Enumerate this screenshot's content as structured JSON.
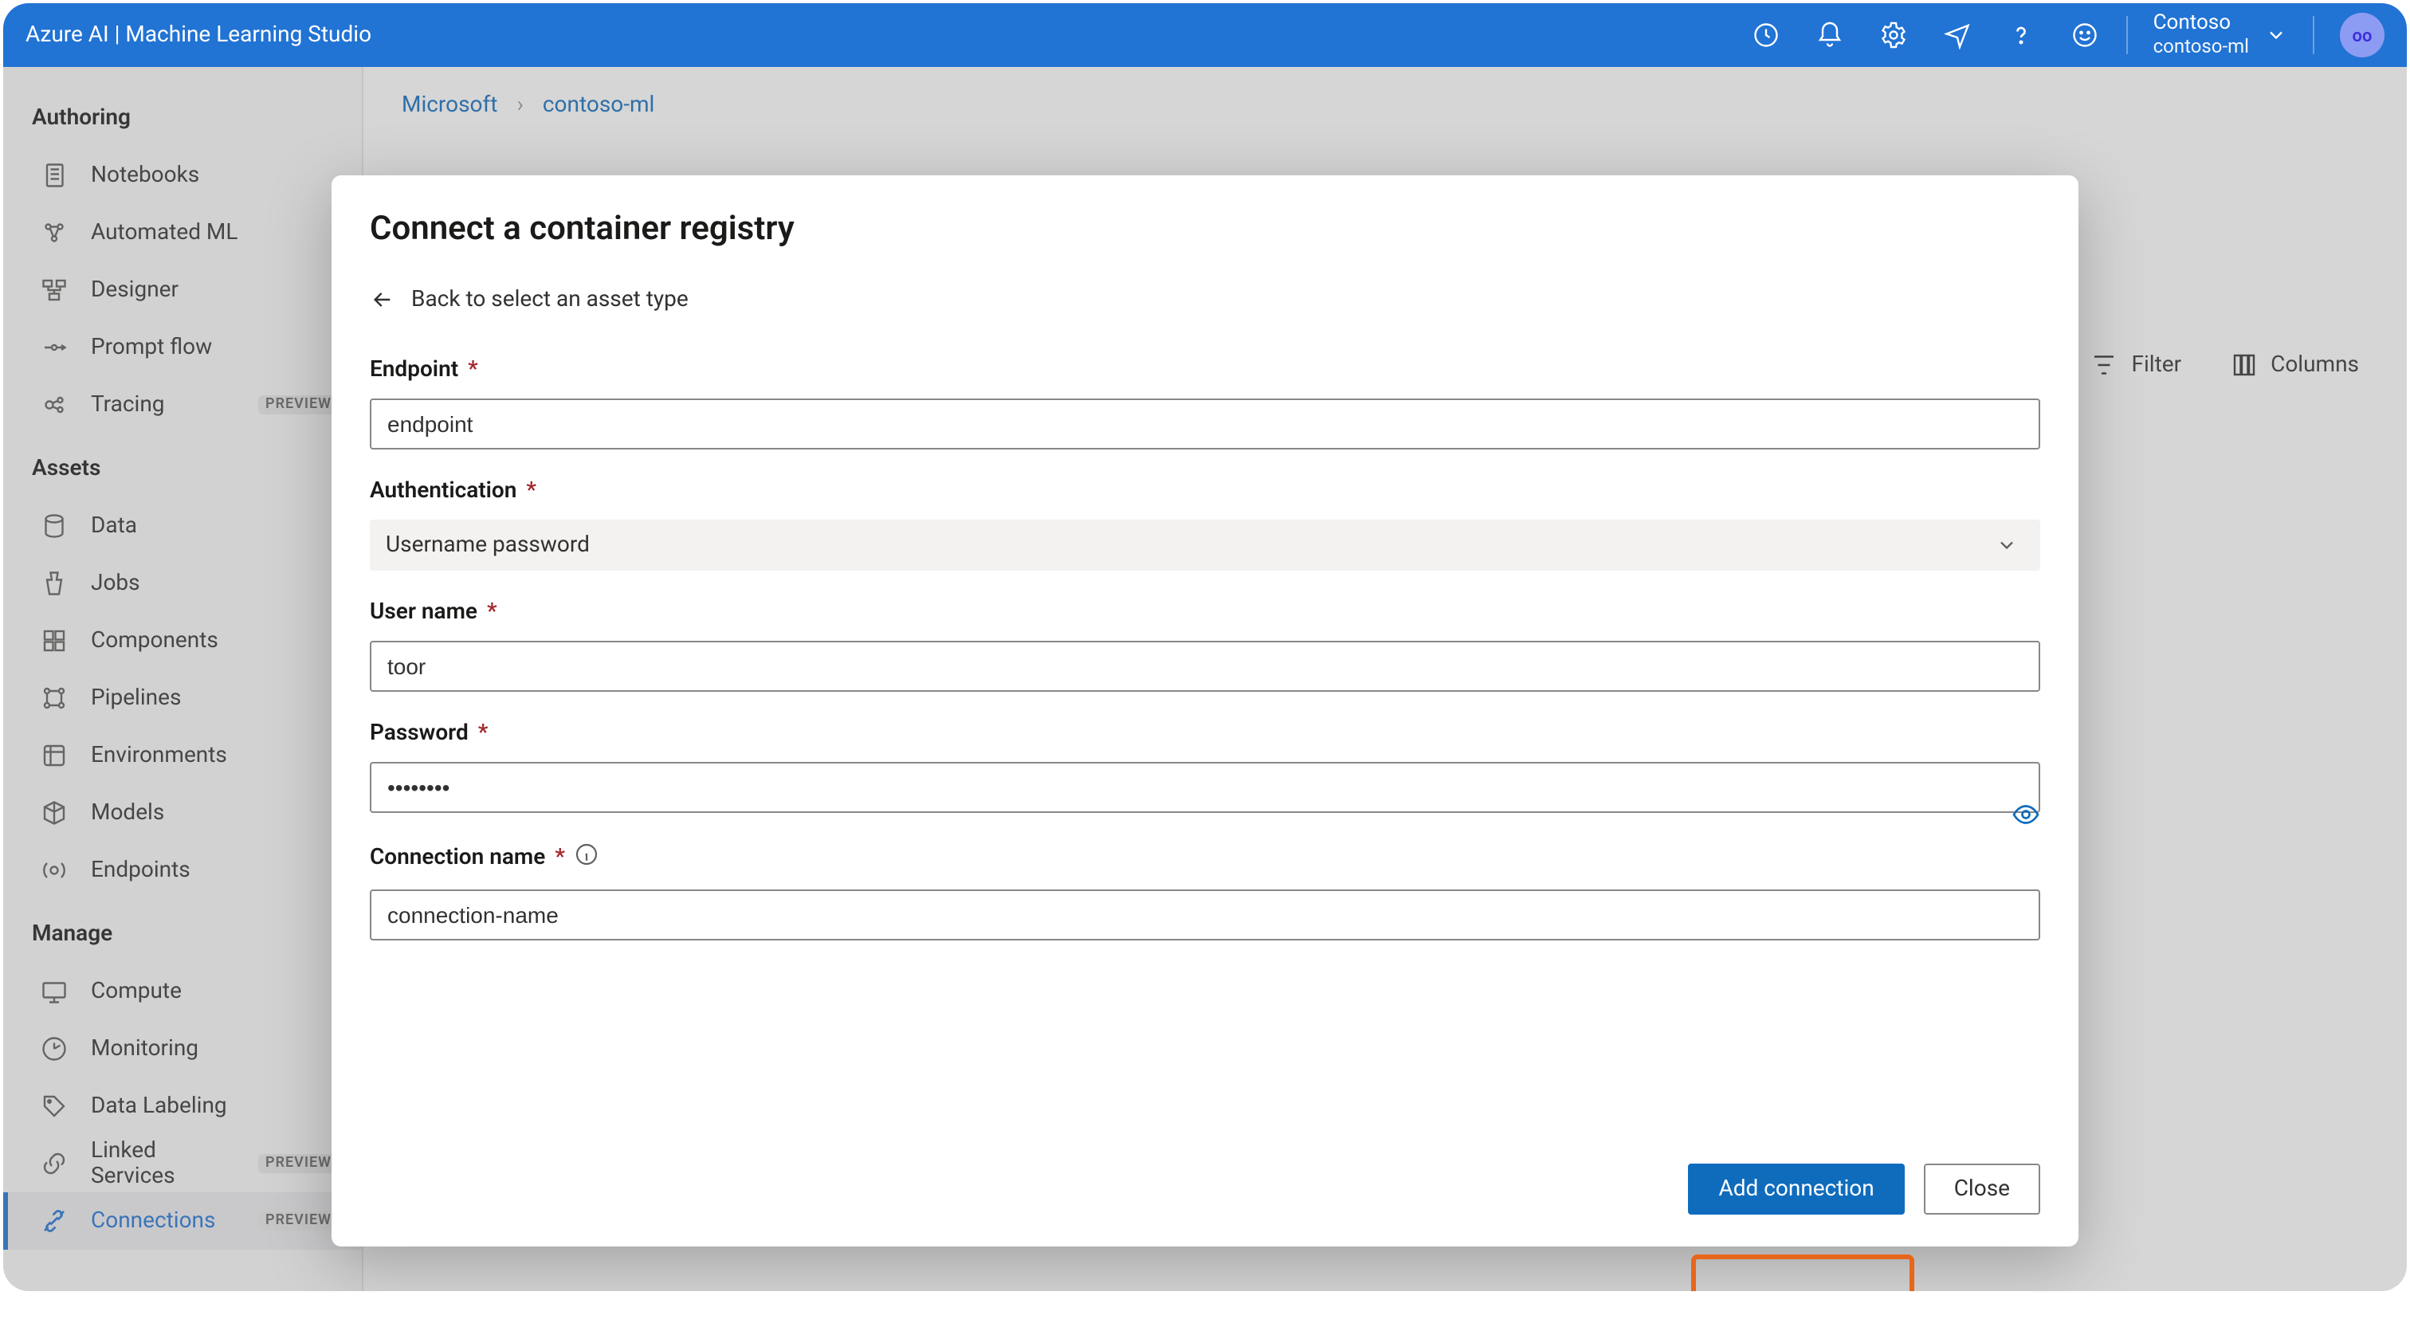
{
  "header": {
    "brand": "Azure AI | Machine Learning Studio",
    "workspace_directory": "Contoso",
    "workspace_name": "contoso-ml",
    "avatar_initials": "oo"
  },
  "sidebar": {
    "sections": [
      {
        "title": "Authoring",
        "items": [
          {
            "label": "Notebooks",
            "icon": "notebook"
          },
          {
            "label": "Automated ML",
            "icon": "automl"
          },
          {
            "label": "Designer",
            "icon": "designer"
          },
          {
            "label": "Prompt flow",
            "icon": "promptflow"
          },
          {
            "label": "Tracing",
            "icon": "tracing",
            "preview": true
          }
        ]
      },
      {
        "title": "Assets",
        "items": [
          {
            "label": "Data",
            "icon": "data"
          },
          {
            "label": "Jobs",
            "icon": "jobs"
          },
          {
            "label": "Components",
            "icon": "components"
          },
          {
            "label": "Pipelines",
            "icon": "pipelines"
          },
          {
            "label": "Environments",
            "icon": "environments"
          },
          {
            "label": "Models",
            "icon": "models"
          },
          {
            "label": "Endpoints",
            "icon": "endpoints"
          }
        ]
      },
      {
        "title": "Manage",
        "items": [
          {
            "label": "Compute",
            "icon": "compute"
          },
          {
            "label": "Monitoring",
            "icon": "monitoring"
          },
          {
            "label": "Data Labeling",
            "icon": "labeling"
          },
          {
            "label": "Linked Services",
            "icon": "linked",
            "preview": true
          },
          {
            "label": "Connections",
            "icon": "connections",
            "preview": true,
            "selected": true
          }
        ]
      }
    ]
  },
  "breadcrumb": {
    "items": [
      "Microsoft",
      "contoso-ml"
    ]
  },
  "toolbar": {
    "filter_label": "Filter",
    "columns_label": "Columns"
  },
  "modal": {
    "title": "Connect a container registry",
    "back_label": "Back to select an asset type",
    "fields": {
      "endpoint_label": "Endpoint",
      "endpoint_value": "endpoint",
      "auth_label": "Authentication",
      "auth_value": "Username password",
      "username_label": "User name",
      "username_value": "toor",
      "password_label": "Password",
      "password_value": "••••••••",
      "connection_name_label": "Connection name",
      "connection_name_value": "connection-name"
    },
    "primary_button": "Add connection",
    "secondary_button": "Close"
  },
  "preview_badge": "PREVIEW"
}
